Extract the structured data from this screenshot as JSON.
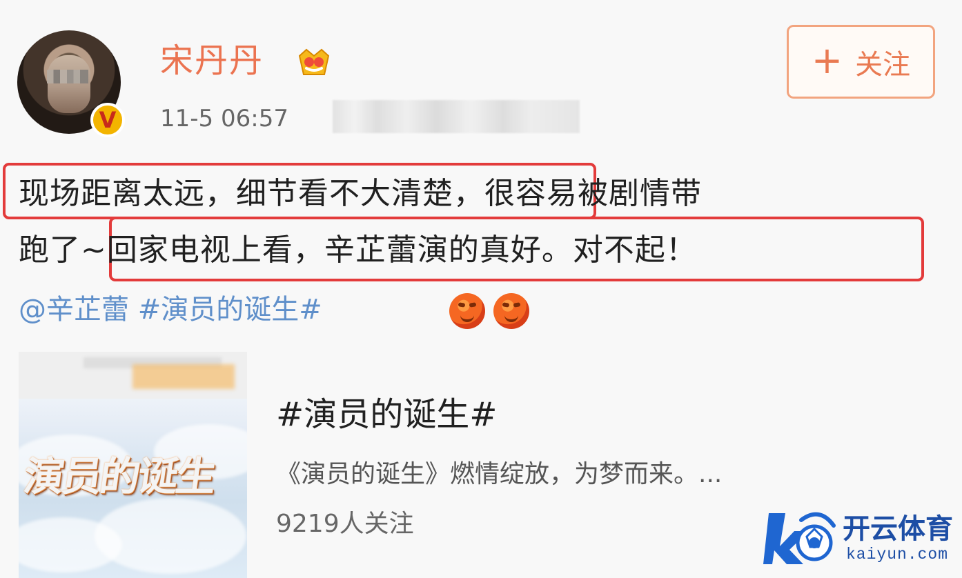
{
  "profile": {
    "username": "宋丹丹",
    "timestamp": "11-5 06:57"
  },
  "follow": {
    "plus": "+",
    "label": "关注"
  },
  "post": {
    "line1": "现场距离太远，细节看不大清楚，很容易被剧情带",
    "line2": "跑了~回家电视上看，辛芷蕾演的真好。对不起！",
    "tags": "@辛芷蕾 #演员的诞生#"
  },
  "card": {
    "poster_text": "演员的诞生",
    "title": "#演员的诞生#",
    "description": "《演员的诞生》燃情绽放，为梦而来。...",
    "followers": "9219人关注"
  },
  "watermark": {
    "brand": "开云体育",
    "site": "kaiyun.com"
  },
  "icons": {
    "avatar": "avatar",
    "verified": "verified-badge-icon",
    "crown": "crown-badge-icon",
    "emoji": "angry-face-icon",
    "watermark_logo": "k-soccer-logo-icon"
  },
  "colors": {
    "background": "#f8f8f8",
    "username": "#eb7350",
    "follow_border": "#f2a47f",
    "highlight": "#e33b3b",
    "link": "#5f8fca",
    "watermark": "#1d4ea5"
  }
}
